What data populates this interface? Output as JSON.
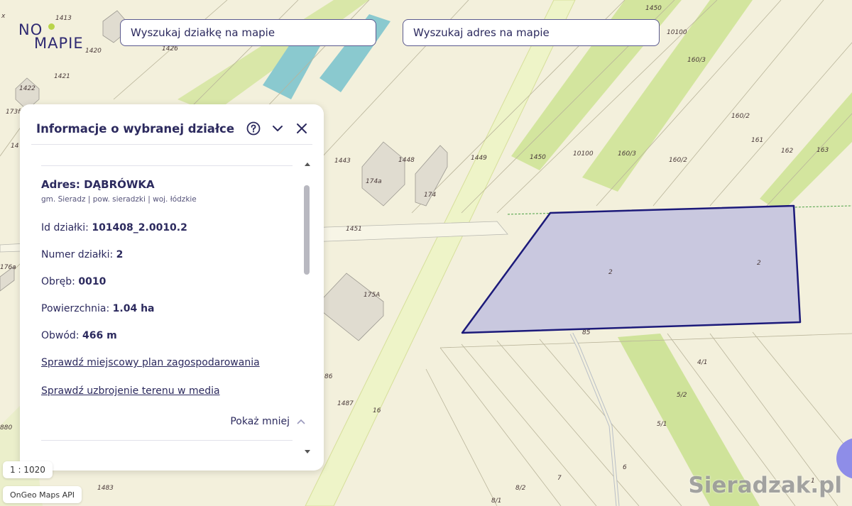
{
  "logo": {
    "line1": "NO",
    "line2": "MAPIE"
  },
  "search_plot": {
    "placeholder": "Wyszukaj działkę na mapie"
  },
  "search_address": {
    "placeholder": "Wyszukaj adres na mapie"
  },
  "panel": {
    "title": "Informacje o wybranej działce",
    "address_label": "Adres:",
    "address_value": "DĄBRÓWKA",
    "address_sub": "gm. Sieradz | pow. sieradzki | woj. łódzkie",
    "fields": [
      {
        "label": "Id działki:",
        "value": "101408_2.0010.2"
      },
      {
        "label": "Numer działki:",
        "value": "2"
      },
      {
        "label": "Obręb:",
        "value": "0010"
      },
      {
        "label": "Powierzchnia:",
        "value": "1.04 ha"
      },
      {
        "label": "Obwód:",
        "value": "466 m"
      }
    ],
    "link_plan": "Sprawdź miejscowy plan zagospodarowania",
    "link_media": "Sprawdź uzbrojenie terenu w media",
    "show_less": "Pokaż mniej",
    "icons": [
      "help-icon",
      "chevron-down-icon",
      "close-icon"
    ]
  },
  "map": {
    "scale": "1 : 1020",
    "attribution": "OnGeo Maps API",
    "watermark": "Sieradzak.pl",
    "parcel_labels": [
      "1413",
      "1426",
      "1421",
      "1422",
      "173f",
      "1420",
      "1443",
      "1448",
      "174a",
      "174",
      "1449",
      "1450",
      "10100",
      "160/3",
      "160/2",
      "161",
      "162",
      "163",
      "1450",
      "10100",
      "160/3",
      "160/2",
      "1451",
      "175A",
      "176a",
      "2",
      "2",
      "85",
      "86",
      "1487",
      "16",
      "4/1",
      "5/2",
      "5/1",
      "6",
      "7",
      "8/2",
      "8/1",
      "1483",
      "880",
      "x",
      "14",
      "1"
    ],
    "colors": {
      "selected_outline": "#1c1a7a",
      "selected_fill": "#c9c8df",
      "green_strip": "#cfe39a",
      "water": "#8ac9cf",
      "base": "#f3f0dc"
    }
  }
}
